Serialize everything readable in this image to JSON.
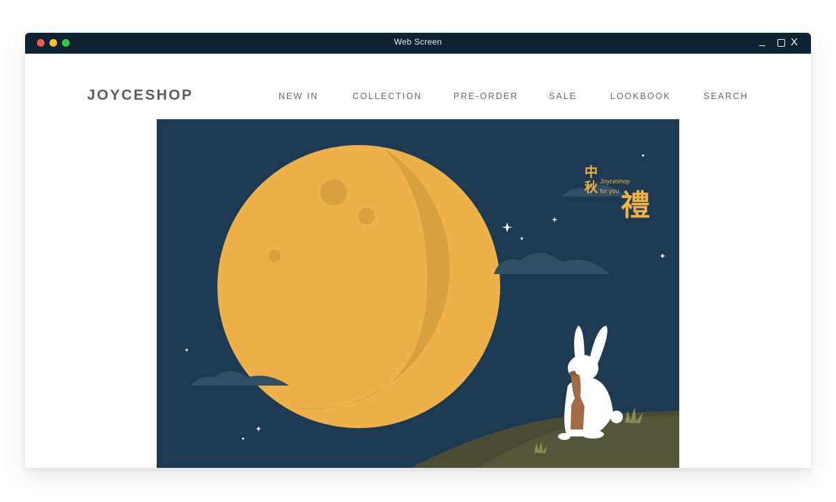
{
  "window": {
    "title": "Web Screen",
    "controls": {
      "minimize": "_",
      "close": "X"
    }
  },
  "header": {
    "brand": "JOYCESHOP",
    "nav": [
      {
        "label": "NEW IN"
      },
      {
        "label": "COLLECTION"
      },
      {
        "label": "PRE-ORDER"
      },
      {
        "label": "SALE"
      },
      {
        "label": "LOOKBOOK"
      },
      {
        "label": "SEARCH"
      }
    ]
  },
  "hero": {
    "greeting": {
      "chars_vertical": [
        "中",
        "秋"
      ],
      "large_char": "禮",
      "line1": "Joyceshop",
      "line2": "for you"
    },
    "colors": {
      "sky": "#1e3a52",
      "moon": "#edb04a",
      "moon_shade": "#d9a040",
      "cloud": "#314e62",
      "hill_light": "#545639",
      "hill_dark": "#4a4b34",
      "rabbit": "#ffffff",
      "lantern": "#a06b45",
      "star": "#ffffff"
    }
  }
}
